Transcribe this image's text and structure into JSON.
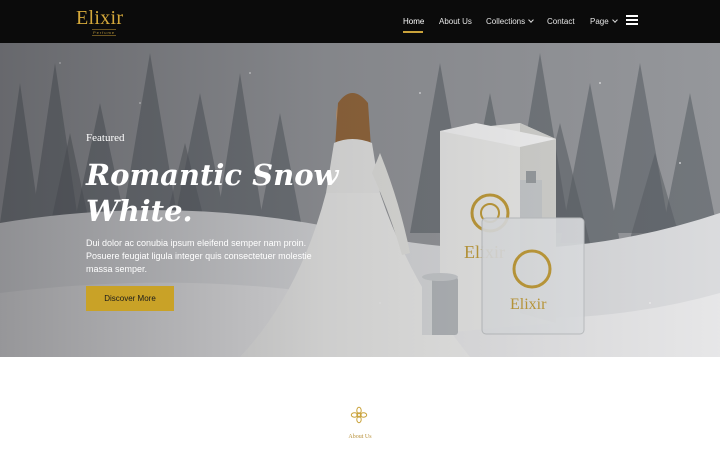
{
  "brand": {
    "name": "Elixir",
    "tagline": "Perfume"
  },
  "nav": {
    "items": [
      {
        "label": "Home",
        "active": true
      },
      {
        "label": "About Us"
      },
      {
        "label": "Collections",
        "dropdown": true
      },
      {
        "label": "Contact"
      },
      {
        "label": "Page",
        "dropdown": true
      }
    ],
    "menu_icon": "hamburger-icon"
  },
  "hero": {
    "kicker": "Featured",
    "title": "Romantic Snow White.",
    "text": "Dui dolor ac conubia ipsum eleifend semper nam proin. Posuere feugiat ligula integer quis consectetuer molestie massa semper.",
    "button": "Discover More",
    "bottle_label": "Elixir",
    "box_label": "Elixir"
  },
  "about": {
    "label": "About Us",
    "icon": "flower-ornament-icon"
  },
  "colors": {
    "accent": "#c9a227",
    "nav_bg": "#0b0b0b",
    "brand_gold": "#d4a83a"
  }
}
